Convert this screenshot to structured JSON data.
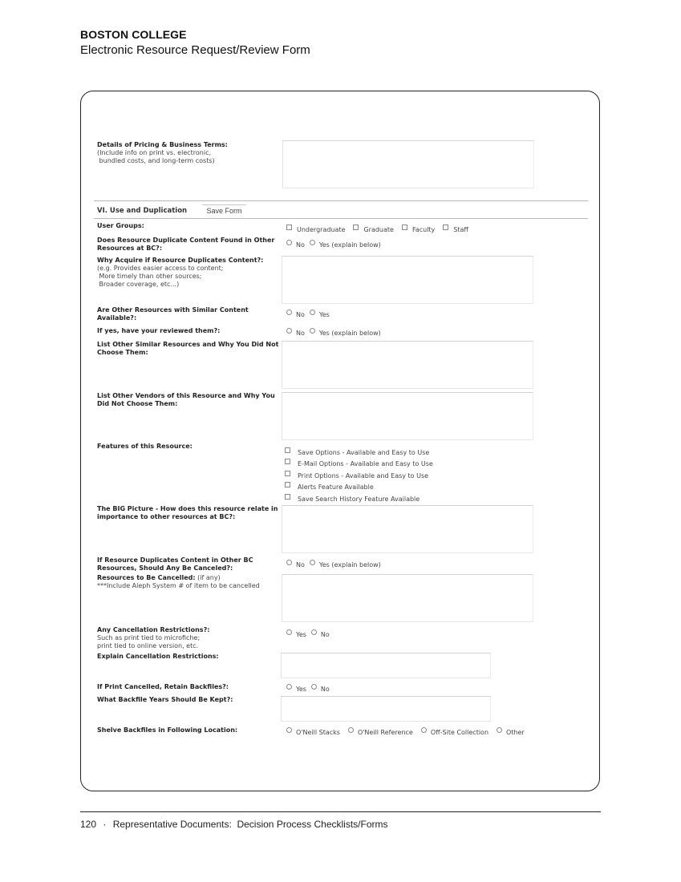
{
  "header": {
    "organization": "BOSTON COLLEGE",
    "title": "Electronic Resource Request/Review Form"
  },
  "form": {
    "pricing": {
      "label": "Details of Pricing & Business Terms:",
      "hint_lines": [
        "(Include info on print vs. electronic,",
        " bundled costs, and long-term costs)"
      ],
      "value": ""
    },
    "section": {
      "title": "VI. Use and Duplication",
      "save_button": "Save Form"
    },
    "user_groups": {
      "label": "User Groups:",
      "options": [
        "Undergraduate",
        "Graduate",
        "Faculty",
        "Staff"
      ]
    },
    "duplicate_content": {
      "label_lines": [
        "Does Resource Duplicate Content Found in Other",
        "Resources at BC?:"
      ],
      "options": [
        "No",
        "Yes (explain below)"
      ]
    },
    "why_acquire": {
      "label": "Why Acquire if Resource Duplicates Content?:",
      "hint_lines": [
        "(e.g. Provides easier access to content;",
        " More timely than other sources;",
        " Broader coverage, etc...)"
      ],
      "value": ""
    },
    "similar_available": {
      "label_lines": [
        "Are Other Resources with Similar Content",
        "Available?:"
      ],
      "options": [
        "No",
        "Yes"
      ]
    },
    "reviewed": {
      "label": "If yes, have your reviewed them?:",
      "options": [
        "No",
        "Yes (explain below)"
      ]
    },
    "list_similar": {
      "label_lines": [
        "List Other Similar Resources and Why You Did Not",
        "Choose Them:"
      ],
      "value": ""
    },
    "list_vendors": {
      "label_lines": [
        "List Other Vendors of this Resource and Why You",
        "Did Not Choose Them:"
      ],
      "value": ""
    },
    "features": {
      "label": "Features of this Resource:",
      "options": [
        "Save Options - Available and Easy to Use",
        "E-Mail Options - Available and Easy to Use",
        "Print Options - Available and Easy to Use",
        "Alerts Feature Available",
        "Save Search History Feature Available"
      ]
    },
    "big_picture": {
      "label_lines": [
        "The BIG Picture - How does this resource relate in",
        "importance to other resources at BC?:"
      ],
      "value": ""
    },
    "should_cancel": {
      "label_lines": [
        "If Resource Duplicates Content in Other BC",
        "Resources, Should Any Be Canceled?:"
      ],
      "options": [
        "No",
        "Yes (explain below)"
      ]
    },
    "to_cancel": {
      "label": "Resources to Be Cancelled:",
      "label_suffix": " (if any)",
      "hint": "***Include Aleph System # of item to be cancelled",
      "value": ""
    },
    "cancel_restrictions": {
      "label": "Any Cancellation Restrictions?:",
      "hint_lines": [
        "Such as print tied to microfiche;",
        "print tied to online version, etc."
      ],
      "options": [
        "Yes",
        "No"
      ]
    },
    "explain_restrictions": {
      "label": "Explain Cancellation Restrictions:",
      "value": ""
    },
    "retain_backfiles": {
      "label": "If Print Cancelled, Retain Backfiles?:",
      "options": [
        "Yes",
        "No"
      ]
    },
    "backfile_years": {
      "label": "What Backfile Years Should Be Kept?:",
      "value": ""
    },
    "shelve_location": {
      "label": "Shelve Backfiles in Following Location:",
      "options": [
        "O'Neill Stacks",
        "O'Neill Reference",
        "Off-Site Collection",
        "Other"
      ]
    }
  },
  "footer": {
    "page_number": "120",
    "separator": "·",
    "text": "Representative Documents:  Decision Process Checklists/Forms"
  }
}
